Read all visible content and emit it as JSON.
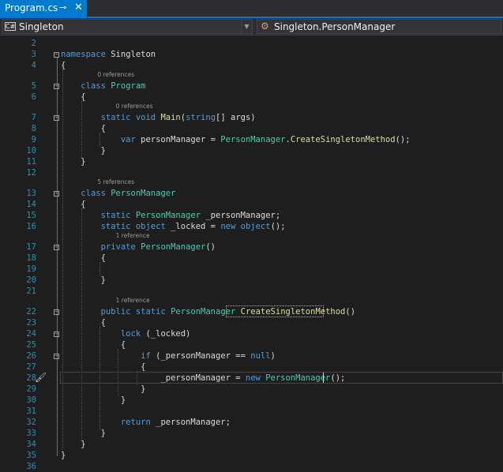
{
  "tab": {
    "title": "Program.cs",
    "pin_glyph": "⊸",
    "close_glyph": "✕"
  },
  "nav": {
    "project": "Singleton",
    "project_icon_text": "C#",
    "member": "Singleton.PersonManager",
    "dropdown_glyph": "▼"
  },
  "editor": {
    "language": "C#",
    "colors": {
      "background": "#1e1e1e",
      "keyword": "#569cd6",
      "type": "#4ec9b0",
      "method": "#dcdcaa",
      "line_number": "#2b91af",
      "change_bar": "#57731c",
      "tab_accent": "#007acc"
    },
    "lines": [
      {
        "n": "2",
        "tokens": []
      },
      {
        "n": "3",
        "tokens": [
          [
            "kw",
            "namespace"
          ],
          [
            "pl",
            " Singleton"
          ]
        ]
      },
      {
        "n": "4",
        "tokens": [
          [
            "pl",
            "{"
          ]
        ]
      },
      {
        "n": "5",
        "lens": "0 references",
        "tokens": [
          [
            "pl",
            "    "
          ],
          [
            "kw",
            "class"
          ],
          [
            "pl",
            " "
          ],
          [
            "ty",
            "Program"
          ]
        ]
      },
      {
        "n": "6",
        "tokens": [
          [
            "pl",
            "    {"
          ]
        ]
      },
      {
        "n": "7",
        "lens": "0 references",
        "tokens": [
          [
            "pl",
            "        "
          ],
          [
            "kw",
            "static"
          ],
          [
            "pl",
            " "
          ],
          [
            "kw",
            "void"
          ],
          [
            "pl",
            " "
          ],
          [
            "mt",
            "Main"
          ],
          [
            "pl",
            "("
          ],
          [
            "kw",
            "string"
          ],
          [
            "pl",
            "[] args)"
          ]
        ]
      },
      {
        "n": "8",
        "tokens": [
          [
            "pl",
            "        {"
          ]
        ]
      },
      {
        "n": "9",
        "tokens": [
          [
            "pl",
            "            "
          ],
          [
            "kw",
            "var"
          ],
          [
            "pl",
            " personManager = "
          ],
          [
            "ty",
            "PersonManager"
          ],
          [
            "pl",
            "."
          ],
          [
            "mt",
            "CreateSingletonMethod"
          ],
          [
            "pl",
            "();"
          ]
        ]
      },
      {
        "n": "10",
        "tokens": [
          [
            "pl",
            "        }"
          ]
        ]
      },
      {
        "n": "11",
        "tokens": [
          [
            "pl",
            "    }"
          ]
        ]
      },
      {
        "n": "12",
        "tokens": []
      },
      {
        "n": "13",
        "lens": "5 references",
        "tokens": [
          [
            "pl",
            "    "
          ],
          [
            "kw",
            "class"
          ],
          [
            "pl",
            " "
          ],
          [
            "ty",
            "PersonManager"
          ]
        ]
      },
      {
        "n": "14",
        "tokens": [
          [
            "pl",
            "    {"
          ]
        ]
      },
      {
        "n": "15",
        "tokens": [
          [
            "pl",
            "        "
          ],
          [
            "kw",
            "static"
          ],
          [
            "pl",
            " "
          ],
          [
            "ty",
            "PersonManager"
          ],
          [
            "pl",
            " _personManager;"
          ]
        ]
      },
      {
        "n": "16",
        "tokens": [
          [
            "pl",
            "        "
          ],
          [
            "kw",
            "static"
          ],
          [
            "pl",
            " "
          ],
          [
            "kw",
            "object"
          ],
          [
            "pl",
            " _locked = "
          ],
          [
            "kw",
            "new"
          ],
          [
            "pl",
            " "
          ],
          [
            "kw",
            "object"
          ],
          [
            "pl",
            "();"
          ]
        ]
      },
      {
        "n": "17",
        "lens": "1 reference",
        "tokens": [
          [
            "pl",
            "        "
          ],
          [
            "kw",
            "private"
          ],
          [
            "pl",
            " "
          ],
          [
            "ty",
            "PersonManager"
          ],
          [
            "pl",
            "()"
          ]
        ]
      },
      {
        "n": "18",
        "tokens": [
          [
            "pl",
            "        {"
          ]
        ]
      },
      {
        "n": "19",
        "tokens": []
      },
      {
        "n": "20",
        "tokens": [
          [
            "pl",
            "        }"
          ]
        ]
      },
      {
        "n": "21",
        "tokens": []
      },
      {
        "n": "22",
        "lens": "1 reference",
        "tokens": [
          [
            "pl",
            "        "
          ],
          [
            "kw",
            "public"
          ],
          [
            "pl",
            " "
          ],
          [
            "kw",
            "static"
          ],
          [
            "pl",
            " "
          ],
          [
            "ty",
            "PersonManager"
          ],
          [
            "pl",
            " "
          ],
          [
            "mt",
            "CreateSingletonMethod"
          ],
          [
            "pl",
            "()"
          ]
        ]
      },
      {
        "n": "23",
        "tokens": [
          [
            "pl",
            "        {"
          ]
        ]
      },
      {
        "n": "24",
        "tokens": [
          [
            "pl",
            "            "
          ],
          [
            "kw",
            "lock"
          ],
          [
            "pl",
            " (_locked)"
          ]
        ]
      },
      {
        "n": "25",
        "tokens": [
          [
            "pl",
            "            {"
          ]
        ]
      },
      {
        "n": "26",
        "tokens": [
          [
            "pl",
            "                "
          ],
          [
            "kw",
            "if"
          ],
          [
            "pl",
            " (_personManager == "
          ],
          [
            "kw",
            "null"
          ],
          [
            "pl",
            ")"
          ]
        ]
      },
      {
        "n": "27",
        "tokens": [
          [
            "pl",
            "                {"
          ]
        ]
      },
      {
        "n": "28",
        "tokens": [
          [
            "pl",
            "                    _personManager = "
          ],
          [
            "kw",
            "new"
          ],
          [
            "pl",
            " "
          ],
          [
            "ty",
            "PersonManager"
          ],
          [
            "pl",
            "();"
          ]
        ]
      },
      {
        "n": "29",
        "tokens": [
          [
            "pl",
            "                }"
          ]
        ]
      },
      {
        "n": "30",
        "tokens": [
          [
            "pl",
            "            }"
          ]
        ]
      },
      {
        "n": "31",
        "tokens": []
      },
      {
        "n": "32",
        "tokens": [
          [
            "pl",
            "            "
          ],
          [
            "kw",
            "return"
          ],
          [
            "pl",
            " _personManager;"
          ]
        ]
      },
      {
        "n": "33",
        "tokens": [
          [
            "pl",
            "        }"
          ]
        ]
      },
      {
        "n": "34",
        "tokens": [
          [
            "pl",
            "    }"
          ]
        ]
      },
      {
        "n": "35",
        "tokens": [
          [
            "pl",
            "}"
          ]
        ]
      },
      {
        "n": "36",
        "tokens": []
      }
    ]
  }
}
